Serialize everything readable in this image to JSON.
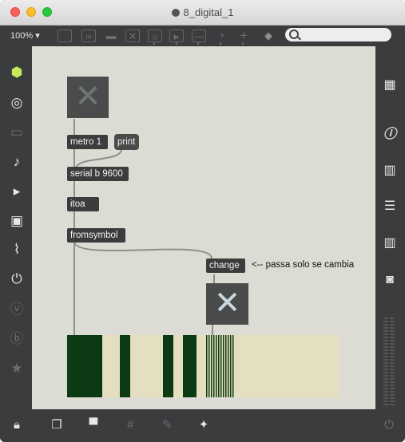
{
  "window": {
    "title": "8_digital_1"
  },
  "toolbar": {
    "zoom": "100% ▾"
  },
  "patch": {
    "objects": {
      "metro": "metro 1",
      "print": "print",
      "serial": "serial b 9600",
      "itoa": "itoa",
      "fromsymbol": "fromsymbol",
      "change": "change"
    },
    "comment": "<-- passa solo se cambia"
  },
  "left_sidebar": {
    "icons": [
      "cube-icon",
      "target-icon",
      "screen-icon",
      "music-note-icon",
      "media-icon",
      "image-icon",
      "paperclip-icon",
      "plug-icon",
      "v-icon",
      "b-icon",
      "star-icon"
    ]
  },
  "right_sidebar": {
    "icons": [
      "grid-icon",
      "info-icon",
      "book-icon",
      "list-icon",
      "book-open-icon",
      "camera-icon"
    ]
  },
  "bottom_bar": {
    "icons": [
      "lock-icon",
      "windows-icon",
      "presentation-icon",
      "grid-icon",
      "pin-icon",
      "wrench-icon",
      "power-icon"
    ]
  },
  "colors": {
    "canvas": "#dcdcd5",
    "object": "#3c3c3c",
    "bar_dark": "#0c3a14",
    "bar_light": "#e3dfc0",
    "accent": "#c7e95c"
  }
}
